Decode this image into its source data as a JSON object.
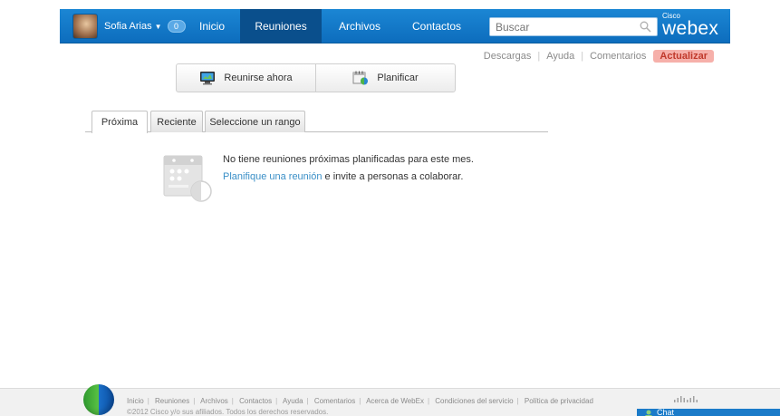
{
  "user": {
    "name": "Sofia Arias",
    "badge_count": "0"
  },
  "nav": {
    "items": [
      {
        "label": "Inicio"
      },
      {
        "label": "Reuniones"
      },
      {
        "label": "Archivos"
      },
      {
        "label": "Contactos"
      }
    ],
    "active": "Reuniones"
  },
  "search": {
    "placeholder": "Buscar"
  },
  "logo": {
    "small": "Cisco",
    "big": "webex"
  },
  "util_links": {
    "downloads": "Descargas",
    "help": "Ayuda",
    "comments": "Comentarios",
    "update": "Actualizar"
  },
  "actions": {
    "meet_now": "Reunirse ahora",
    "schedule": "Planificar"
  },
  "tabs": [
    {
      "label": "Próxima"
    },
    {
      "label": "Reciente"
    },
    {
      "label": "Seleccione un rango"
    }
  ],
  "empty_state": {
    "line1": "No tiene reuniones próximas planificadas para este mes.",
    "link": "Planifique una reunión",
    "line2_rest": " e invite a personas a colaborar."
  },
  "footer": {
    "links": [
      "Inicio",
      "Reuniones",
      "Archivos",
      "Contactos",
      "Ayuda",
      "Comentarios",
      "Acerca de WebEx",
      "Condiciones del servicio",
      "Política de privacidad"
    ],
    "copyright": "©2012 Cisco y/o sus afiliados. Todos los derechos reservados."
  },
  "chat": {
    "label": "Chat"
  },
  "colors": {
    "nav_bg": "#1480cd",
    "nav_active": "#0a4f8c",
    "link": "#3a8fc7",
    "update_bg": "#f6b0aa",
    "update_text": "#c0392b"
  }
}
